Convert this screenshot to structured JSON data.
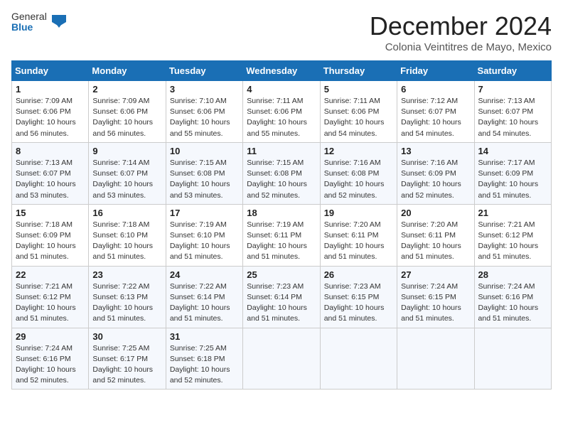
{
  "header": {
    "logo": {
      "general": "General",
      "blue": "Blue"
    },
    "title": "December 2024",
    "location": "Colonia Veintitres de Mayo, Mexico"
  },
  "weekdays": [
    "Sunday",
    "Monday",
    "Tuesday",
    "Wednesday",
    "Thursday",
    "Friday",
    "Saturday"
  ],
  "weeks": [
    [
      {
        "day": "1",
        "sunrise": "7:09 AM",
        "sunset": "6:06 PM",
        "daylight": "10 hours and 56 minutes."
      },
      {
        "day": "2",
        "sunrise": "7:09 AM",
        "sunset": "6:06 PM",
        "daylight": "10 hours and 56 minutes."
      },
      {
        "day": "3",
        "sunrise": "7:10 AM",
        "sunset": "6:06 PM",
        "daylight": "10 hours and 55 minutes."
      },
      {
        "day": "4",
        "sunrise": "7:11 AM",
        "sunset": "6:06 PM",
        "daylight": "10 hours and 55 minutes."
      },
      {
        "day": "5",
        "sunrise": "7:11 AM",
        "sunset": "6:06 PM",
        "daylight": "10 hours and 54 minutes."
      },
      {
        "day": "6",
        "sunrise": "7:12 AM",
        "sunset": "6:07 PM",
        "daylight": "10 hours and 54 minutes."
      },
      {
        "day": "7",
        "sunrise": "7:13 AM",
        "sunset": "6:07 PM",
        "daylight": "10 hours and 54 minutes."
      }
    ],
    [
      {
        "day": "8",
        "sunrise": "7:13 AM",
        "sunset": "6:07 PM",
        "daylight": "10 hours and 53 minutes."
      },
      {
        "day": "9",
        "sunrise": "7:14 AM",
        "sunset": "6:07 PM",
        "daylight": "10 hours and 53 minutes."
      },
      {
        "day": "10",
        "sunrise": "7:15 AM",
        "sunset": "6:08 PM",
        "daylight": "10 hours and 53 minutes."
      },
      {
        "day": "11",
        "sunrise": "7:15 AM",
        "sunset": "6:08 PM",
        "daylight": "10 hours and 52 minutes."
      },
      {
        "day": "12",
        "sunrise": "7:16 AM",
        "sunset": "6:08 PM",
        "daylight": "10 hours and 52 minutes."
      },
      {
        "day": "13",
        "sunrise": "7:16 AM",
        "sunset": "6:09 PM",
        "daylight": "10 hours and 52 minutes."
      },
      {
        "day": "14",
        "sunrise": "7:17 AM",
        "sunset": "6:09 PM",
        "daylight": "10 hours and 51 minutes."
      }
    ],
    [
      {
        "day": "15",
        "sunrise": "7:18 AM",
        "sunset": "6:09 PM",
        "daylight": "10 hours and 51 minutes."
      },
      {
        "day": "16",
        "sunrise": "7:18 AM",
        "sunset": "6:10 PM",
        "daylight": "10 hours and 51 minutes."
      },
      {
        "day": "17",
        "sunrise": "7:19 AM",
        "sunset": "6:10 PM",
        "daylight": "10 hours and 51 minutes."
      },
      {
        "day": "18",
        "sunrise": "7:19 AM",
        "sunset": "6:11 PM",
        "daylight": "10 hours and 51 minutes."
      },
      {
        "day": "19",
        "sunrise": "7:20 AM",
        "sunset": "6:11 PM",
        "daylight": "10 hours and 51 minutes."
      },
      {
        "day": "20",
        "sunrise": "7:20 AM",
        "sunset": "6:11 PM",
        "daylight": "10 hours and 51 minutes."
      },
      {
        "day": "21",
        "sunrise": "7:21 AM",
        "sunset": "6:12 PM",
        "daylight": "10 hours and 51 minutes."
      }
    ],
    [
      {
        "day": "22",
        "sunrise": "7:21 AM",
        "sunset": "6:12 PM",
        "daylight": "10 hours and 51 minutes."
      },
      {
        "day": "23",
        "sunrise": "7:22 AM",
        "sunset": "6:13 PM",
        "daylight": "10 hours and 51 minutes."
      },
      {
        "day": "24",
        "sunrise": "7:22 AM",
        "sunset": "6:14 PM",
        "daylight": "10 hours and 51 minutes."
      },
      {
        "day": "25",
        "sunrise": "7:23 AM",
        "sunset": "6:14 PM",
        "daylight": "10 hours and 51 minutes."
      },
      {
        "day": "26",
        "sunrise": "7:23 AM",
        "sunset": "6:15 PM",
        "daylight": "10 hours and 51 minutes."
      },
      {
        "day": "27",
        "sunrise": "7:24 AM",
        "sunset": "6:15 PM",
        "daylight": "10 hours and 51 minutes."
      },
      {
        "day": "28",
        "sunrise": "7:24 AM",
        "sunset": "6:16 PM",
        "daylight": "10 hours and 51 minutes."
      }
    ],
    [
      {
        "day": "29",
        "sunrise": "7:24 AM",
        "sunset": "6:16 PM",
        "daylight": "10 hours and 52 minutes."
      },
      {
        "day": "30",
        "sunrise": "7:25 AM",
        "sunset": "6:17 PM",
        "daylight": "10 hours and 52 minutes."
      },
      {
        "day": "31",
        "sunrise": "7:25 AM",
        "sunset": "6:18 PM",
        "daylight": "10 hours and 52 minutes."
      },
      null,
      null,
      null,
      null
    ]
  ]
}
